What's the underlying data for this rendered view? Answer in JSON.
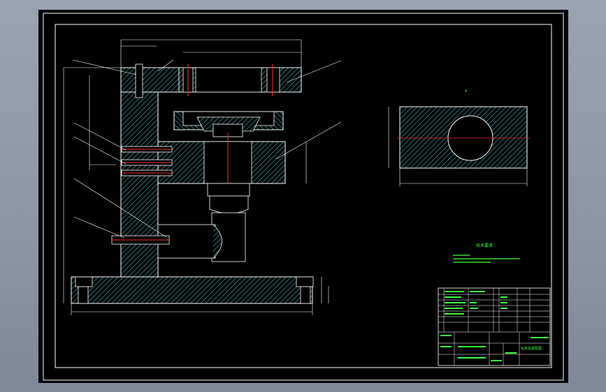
{
  "colors": {
    "background": "#000000",
    "border": "#ffffff",
    "hatch": "#2f8f8f",
    "centerline": "#ff2a2a",
    "text": "#ffffff",
    "notes": "#3cff3c"
  },
  "title_block": {
    "drawing_title": "钻夹具装配图"
  },
  "notes": {
    "heading": "技术要求"
  },
  "section_label": "A"
}
